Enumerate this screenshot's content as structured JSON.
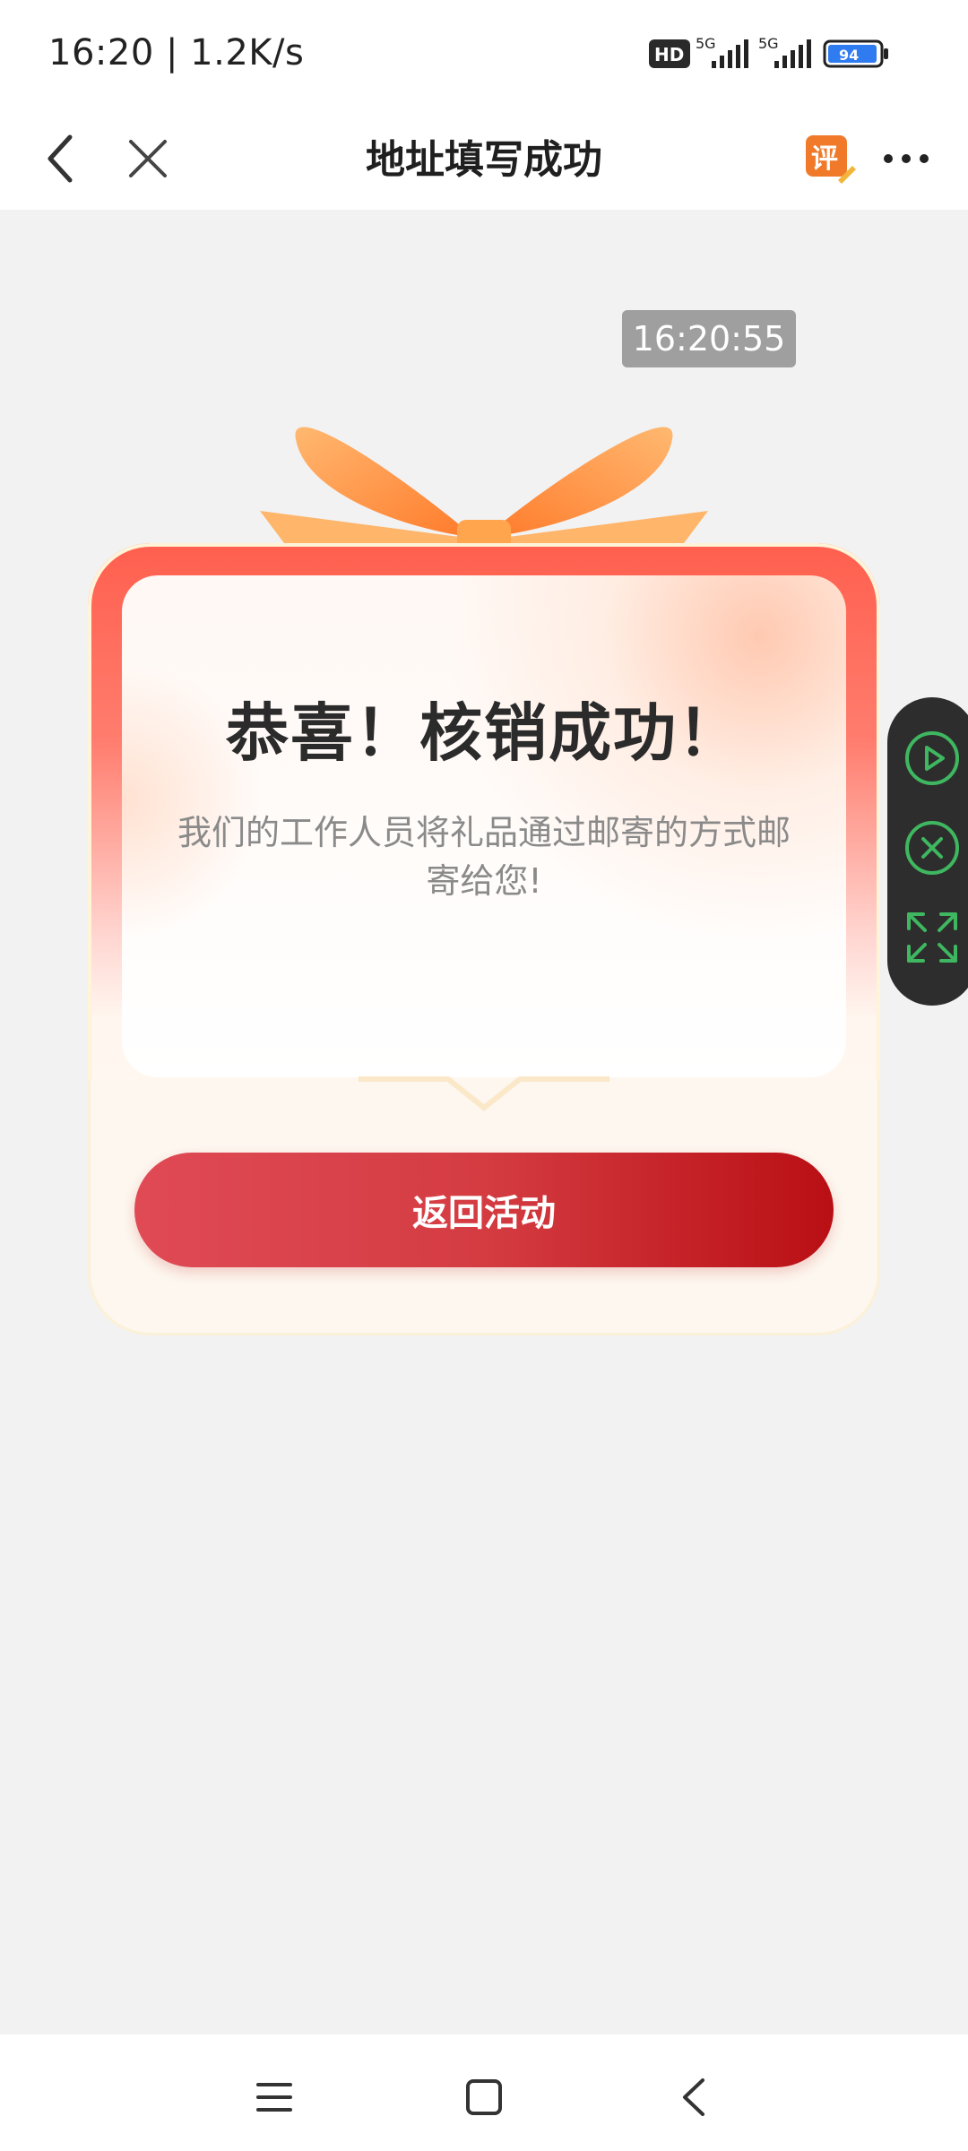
{
  "status_bar": {
    "time": "16:20 | 1.2K/s",
    "battery": "94",
    "network_1": "5G",
    "network_2": "5G",
    "hd_label": "HD"
  },
  "nav": {
    "title": "地址填写成功",
    "badge_icon_label": "评"
  },
  "timestamp": "16:20:55",
  "card": {
    "title": "恭喜！核销成功！",
    "description": "我们的工作人员将礼品通过邮寄的方式邮寄给您!",
    "button_label": "返回活动"
  },
  "colors": {
    "accent": "#d43c42",
    "float_green": "#3fb760",
    "badge_orange": "#f07a2a"
  }
}
